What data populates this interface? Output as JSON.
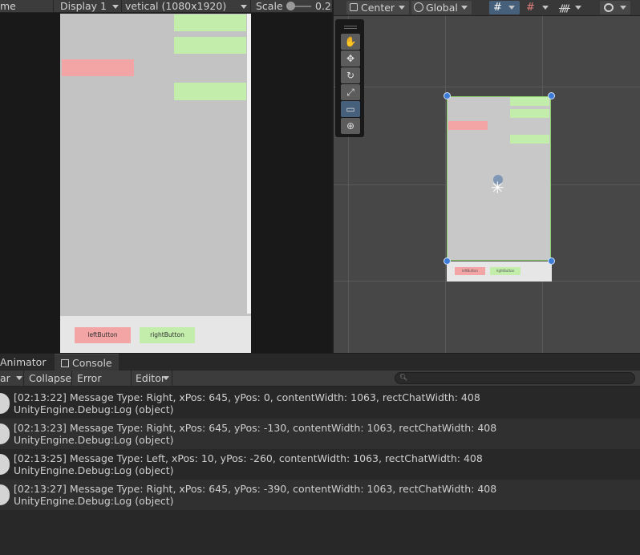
{
  "game_view": {
    "tab_label": "me",
    "display": "Display 1",
    "resolution": "vetical (1080x1920)",
    "scale_label": "Scale",
    "scale_value": "0.2",
    "left_button": "leftButton",
    "right_button": "rightButton"
  },
  "scene_view": {
    "pivot_mode": "Center",
    "space_mode": "Global",
    "mini_left_button": "leftButton",
    "mini_right_button": "rightButton"
  },
  "console": {
    "tabs": [
      "Animator",
      "Console"
    ],
    "toolbar": {
      "clear": "ar",
      "collapse": "Collapse",
      "error_pause": "Error Pause",
      "editor": "Editor"
    },
    "search_placeholder": "",
    "logs": [
      {
        "message": "[02:13:22] Message Type: Right, xPos: 645, yPos: 0, contentWidth: 1063, rectChatWidth: 408",
        "source": "UnityEngine.Debug:Log (object)"
      },
      {
        "message": "[02:13:23] Message Type: Right, xPos: 645, yPos: -130, contentWidth: 1063, rectChatWidth: 408",
        "source": "UnityEngine.Debug:Log (object)"
      },
      {
        "message": "[02:13:25] Message Type: Left, xPos: 10, yPos: -260, contentWidth: 1063, rectChatWidth: 408",
        "source": "UnityEngine.Debug:Log (object)"
      },
      {
        "message": "[02:13:27] Message Type: Right, xPos: 645, yPos: -390, contentWidth: 1063, rectChatWidth: 408",
        "source": "UnityEngine.Debug:Log (object)"
      }
    ]
  },
  "colors": {
    "right_message": "#c3edaa",
    "left_message": "#f3a4a4",
    "selection_handle": "#3d7cd6",
    "active_tool": "#46607c"
  },
  "icons": {
    "scene_tools": [
      "hand-icon",
      "move-icon",
      "rotate-icon",
      "scale-icon",
      "rect-transform-icon",
      "transform-icon"
    ],
    "console_tab": "console-icon",
    "log_entry": "info-log-icon"
  }
}
